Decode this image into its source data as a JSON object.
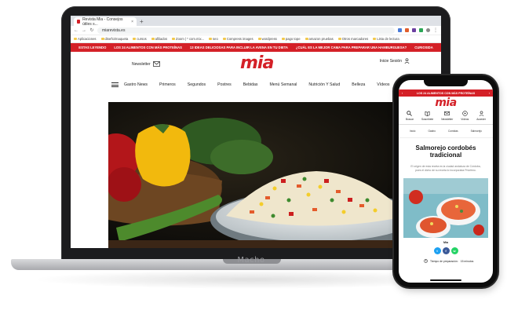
{
  "brand": {
    "accent": "#d42027"
  },
  "laptop": {
    "brand_label": "Macho"
  },
  "browser": {
    "tab_title": "Revista Mia - Consejos útiles s...",
    "tab_close": "×",
    "new_tab": "+",
    "url": "miarevista.es",
    "bookmarks": [
      "Aplicaciones",
      "diseño/maqueta",
      "cursos",
      "afiliados",
      "Zoom | * com.mix...",
      "seo",
      "Compress images",
      "wordpress",
      "pago tope",
      "amazon pruebas",
      "Otros marcadores",
      "Lista de lectura"
    ]
  },
  "site": {
    "promo": [
      "ESTAS LEYENDO",
      "LOS 24 ALIMENTOS CON MÁS PROTEÍNAS",
      "13 IDEAS DELICIOSAS PARA INCLUIR LA AVENA EN TU DIETA",
      "¿CUÁL ES LA MEJOR CAMA PARA PREPARAR UNA HAMBURGUESA?",
      "CURIOSIDA"
    ],
    "logo": "mia",
    "newsletter": "Newsletter",
    "login": "Inicie Sesión",
    "nav": [
      "Gastro News",
      "Primeros",
      "Segundos",
      "Postres",
      "Bebidas",
      "Menú Semanal",
      "Nutrición Y Salud",
      "Belleza",
      "Vídeos"
    ]
  },
  "phone": {
    "promo": "LOS 24 ALIMENTOS CON MÁS PROTEÍNAS",
    "logo": "mia",
    "icons": [
      "Buscar",
      "Suscríbete",
      "Newsletter",
      "Vídeos",
      "Acceder"
    ],
    "breadcrumb": [
      "Inicio",
      "Gastro",
      "Comidas",
      "Salmorejo"
    ],
    "title": "Salmorejo cordobés tradicional",
    "lead": "El origen de esta receta es la ciudad andaluza de Córdoba, pues el dicho de su receta lo incorporaba Prioritmo.",
    "author": "Mía",
    "prep_label": "Tiempo de preparación:",
    "prep_value": "15 minutos"
  }
}
